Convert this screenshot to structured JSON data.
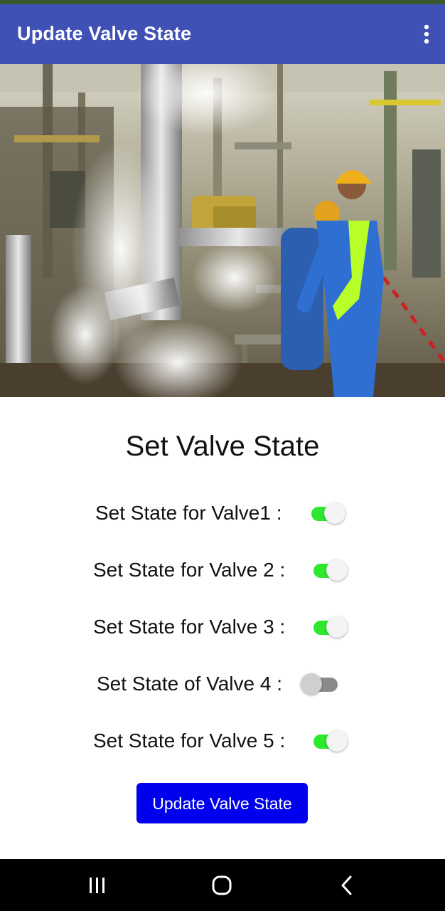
{
  "app_bar": {
    "title": "Update Valve State",
    "menu_icon": "more-vert-icon",
    "color": "#3f51b5"
  },
  "hero_image": {
    "subject": "industrial-plant-workers-photo"
  },
  "main": {
    "heading": "Set Valve State",
    "valves": [
      {
        "label": "Set State for Valve1 :",
        "on": true
      },
      {
        "label": "Set State for Valve 2 :",
        "on": true
      },
      {
        "label": "Set State for Valve 3 :",
        "on": true
      },
      {
        "label": "Set State of Valve 4 :",
        "on": false
      },
      {
        "label": "Set State for Valve 5 :",
        "on": true
      }
    ],
    "update_button_label": "Update Valve State",
    "switch_on_color": "#2ee82e",
    "button_color": "#0000ee"
  },
  "nav_bar": {
    "recents_icon": "recents-icon",
    "home_icon": "home-icon",
    "back_icon": "back-icon"
  }
}
